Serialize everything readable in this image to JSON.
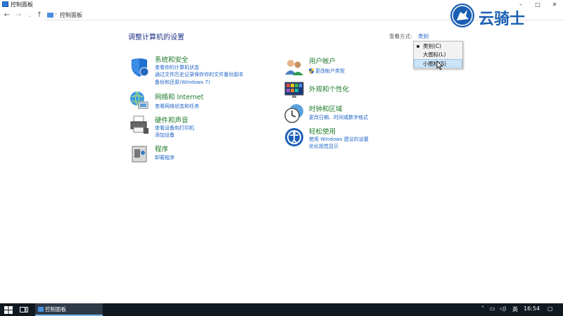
{
  "window": {
    "title": "控制面板"
  },
  "nav": {
    "address_text": "控制面板"
  },
  "page_title": "调整计算机的设置",
  "view_by": {
    "label": "查看方式:",
    "value": "类别",
    "options": [
      {
        "label": "类别(C)",
        "selected": true
      },
      {
        "label": "大图标(L)",
        "selected": false
      },
      {
        "label": "小图标(S)",
        "selected": false,
        "hovered": true
      }
    ]
  },
  "categories_left": [
    {
      "title": "系统和安全",
      "icon": "shield-icon",
      "links": [
        "查看你的计算机状态",
        "通过文件历史记录保存你的文件备份副本",
        "备份和还原(Windows 7)"
      ]
    },
    {
      "title": "网络和 Internet",
      "icon": "network-globe-icon",
      "links": [
        "查看网络状态和任务"
      ]
    },
    {
      "title": "硬件和声音",
      "icon": "printer-icon",
      "links": [
        "查看设备和打印机",
        "添加设备"
      ]
    },
    {
      "title": "程序",
      "icon": "programs-icon",
      "links": [
        "卸载程序"
      ]
    }
  ],
  "categories_right": [
    {
      "title": "用户帐户",
      "icon": "users-icon",
      "links": [
        "更改帐户类型"
      ]
    },
    {
      "title": "外观和个性化",
      "icon": "monitor-icon",
      "links": []
    },
    {
      "title": "时钟和区域",
      "icon": "clock-globe-icon",
      "links": [
        "更改日期、时间或数字格式"
      ]
    },
    {
      "title": "轻松使用",
      "icon": "ease-of-access-icon",
      "links": [
        "使用 Windows 建议的设置",
        "优化视觉显示"
      ]
    }
  ],
  "taskbar": {
    "app_label": "控制面板",
    "ime": "英",
    "time": "16:54"
  },
  "watermark": {
    "text": "云骑士"
  },
  "colors": {
    "link": "#1e64c8",
    "category_title": "#1e7a2a",
    "page_title": "#1e3287",
    "taskbar": "#101820"
  }
}
